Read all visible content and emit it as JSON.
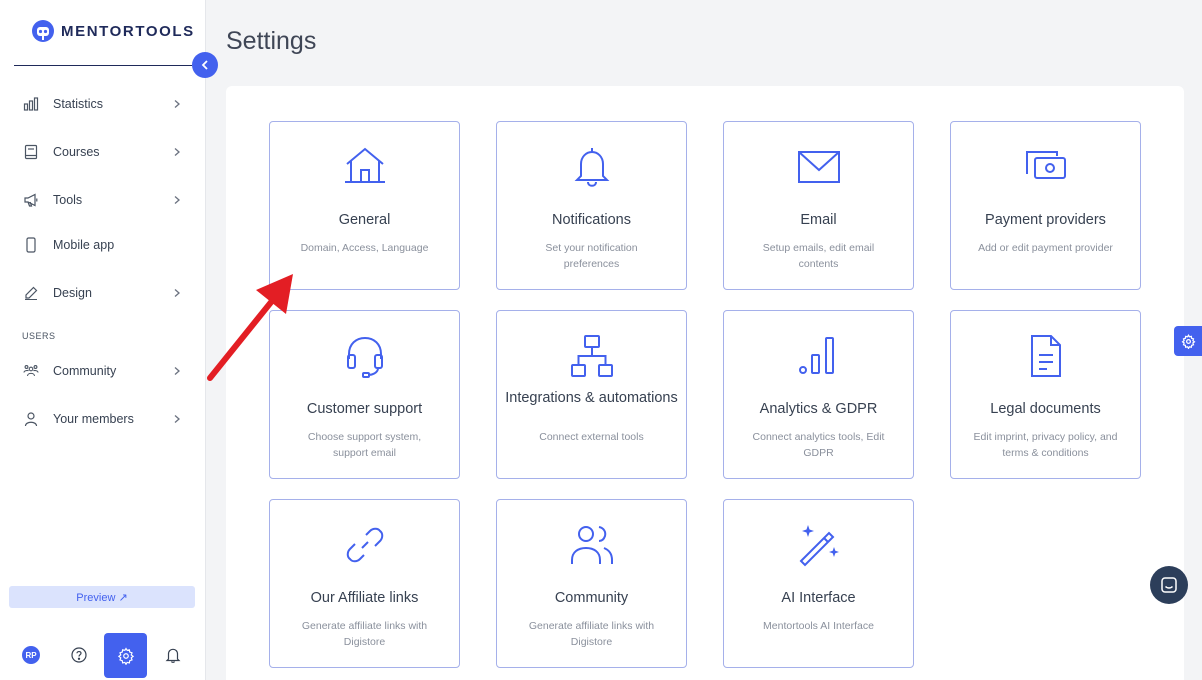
{
  "brand": {
    "name": "MENTORTOOLS",
    "accent": "#4361ee",
    "navy": "#1f2a5a"
  },
  "sidebar": {
    "items": [
      {
        "label": "Statistics",
        "icon": "bar-chart-icon",
        "has_submenu": true
      },
      {
        "label": "Courses",
        "icon": "book-icon",
        "has_submenu": true
      },
      {
        "label": "Tools",
        "icon": "megaphone-icon",
        "has_submenu": true
      },
      {
        "label": "Mobile app",
        "icon": "mobile-icon",
        "has_submenu": false
      },
      {
        "label": "Design",
        "icon": "pencil-icon",
        "has_submenu": true
      }
    ],
    "section_users": "USERS",
    "user_items": [
      {
        "label": "Community",
        "icon": "people-icon",
        "has_submenu": true
      },
      {
        "label": "Your members",
        "icon": "user-icon",
        "has_submenu": true
      }
    ],
    "preview_label": "Preview ↗",
    "avatar_initials": "RP"
  },
  "page": {
    "title": "Settings"
  },
  "cards": [
    {
      "title": "General",
      "desc": "Domain, Access, Language",
      "icon": "home-icon"
    },
    {
      "title": "Notifications",
      "desc": "Set your notification preferences",
      "icon": "bell-icon"
    },
    {
      "title": "Email",
      "desc": "Setup emails, edit email contents",
      "icon": "envelope-icon"
    },
    {
      "title": "Payment providers",
      "desc": "Add or edit payment provider",
      "icon": "cash-icon"
    },
    {
      "title": "Customer support",
      "desc": "Choose support system, support email",
      "icon": "headset-icon"
    },
    {
      "title": "Integrations & automations",
      "desc": "Connect external tools",
      "icon": "hierarchy-icon"
    },
    {
      "title": "Analytics & GDPR",
      "desc": "Connect analytics tools, Edit GDPR",
      "icon": "analytics-icon"
    },
    {
      "title": "Legal documents",
      "desc": "Edit imprint, privacy policy, and terms & conditions",
      "icon": "document-icon"
    },
    {
      "title": "Our Affiliate links",
      "desc": "Generate affiliate links with Digistore",
      "icon": "link-icon"
    },
    {
      "title": "Community",
      "desc": "Generate affiliate links with Digistore",
      "icon": "users-icon"
    },
    {
      "title": "AI Interface",
      "desc": "Mentortools AI Interface",
      "icon": "magic-wand-icon"
    }
  ]
}
